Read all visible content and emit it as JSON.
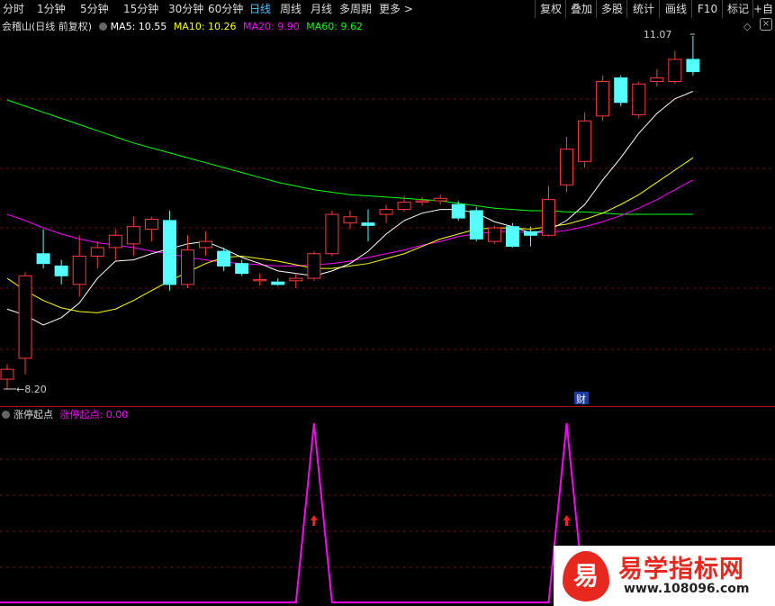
{
  "toolbar": {
    "tabs": [
      "分时",
      "1分钟",
      "5分钟",
      "15分钟",
      "30分钟",
      "60分钟",
      "日线",
      "周线",
      "月线",
      "多周期",
      "更多 >"
    ],
    "active_index": 6,
    "right_buttons": [
      "复权",
      "叠加",
      "多股",
      "统计",
      "画线",
      "F10",
      "标记",
      "+自"
    ]
  },
  "main_chart": {
    "title": "会稽山(日线 前复权)",
    "ma5": "MA5: 10.55",
    "ma10": "MA10: 10.26",
    "ma20": "MA20: 9.90",
    "ma60": "MA60: 9.62",
    "high_label": "11.07",
    "low_label": "8.20",
    "finance_marker": "财"
  },
  "indicator_panel": {
    "title": "涨停起点",
    "value_label": "涨停起点: 0.00"
  },
  "watermark": {
    "glyph": "易",
    "name": "易学指标网",
    "url": "www.108096.com"
  },
  "colors": {
    "up": "#ff3b3b",
    "down": "#54ffff",
    "ma5": "#ffffff",
    "ma10": "#ffff00",
    "ma20": "#ff00ff",
    "ma60": "#00ff00",
    "grid": "#7a0b0b",
    "indicator": "#ff00ff"
  },
  "chart_data": {
    "type": "candlestick",
    "y_range": [
      8.2,
      11.07
    ],
    "candles": [
      {
        "o": 8.28,
        "h": 8.4,
        "l": 8.2,
        "c": 8.36
      },
      {
        "o": 8.45,
        "h": 9.15,
        "l": 8.32,
        "c": 9.12
      },
      {
        "o": 9.3,
        "h": 9.5,
        "l": 9.18,
        "c": 9.22
      },
      {
        "o": 9.2,
        "h": 9.25,
        "l": 9.05,
        "c": 9.12
      },
      {
        "o": 9.05,
        "h": 9.45,
        "l": 8.95,
        "c": 9.28
      },
      {
        "o": 9.28,
        "h": 9.4,
        "l": 9.18,
        "c": 9.35
      },
      {
        "o": 9.35,
        "h": 9.5,
        "l": 9.25,
        "c": 9.45
      },
      {
        "o": 9.38,
        "h": 9.6,
        "l": 9.28,
        "c": 9.52
      },
      {
        "o": 9.5,
        "h": 9.6,
        "l": 9.4,
        "c": 9.58
      },
      {
        "o": 9.57,
        "h": 9.65,
        "l": 9.0,
        "c": 9.05
      },
      {
        "o": 9.05,
        "h": 9.45,
        "l": 9.02,
        "c": 9.33
      },
      {
        "o": 9.35,
        "h": 9.48,
        "l": 9.28,
        "c": 9.4
      },
      {
        "o": 9.32,
        "h": 9.35,
        "l": 9.16,
        "c": 9.2
      },
      {
        "o": 9.22,
        "h": 9.25,
        "l": 9.12,
        "c": 9.14
      },
      {
        "o": 9.08,
        "h": 9.14,
        "l": 9.04,
        "c": 9.09
      },
      {
        "o": 9.07,
        "h": 9.1,
        "l": 9.04,
        "c": 9.05
      },
      {
        "o": 9.08,
        "h": 9.14,
        "l": 9.02,
        "c": 9.1
      },
      {
        "o": 9.1,
        "h": 9.32,
        "l": 9.08,
        "c": 9.3
      },
      {
        "o": 9.3,
        "h": 9.65,
        "l": 9.28,
        "c": 9.62
      },
      {
        "o": 9.55,
        "h": 9.65,
        "l": 9.5,
        "c": 9.6
      },
      {
        "o": 9.55,
        "h": 9.66,
        "l": 9.4,
        "c": 9.53
      },
      {
        "o": 9.62,
        "h": 9.7,
        "l": 9.55,
        "c": 9.66
      },
      {
        "o": 9.66,
        "h": 9.77,
        "l": 9.64,
        "c": 9.72
      },
      {
        "o": 9.72,
        "h": 9.76,
        "l": 9.69,
        "c": 9.73
      },
      {
        "o": 9.73,
        "h": 9.78,
        "l": 9.7,
        "c": 9.75
      },
      {
        "o": 9.7,
        "h": 9.73,
        "l": 9.57,
        "c": 9.59
      },
      {
        "o": 9.65,
        "h": 9.68,
        "l": 9.4,
        "c": 9.42
      },
      {
        "o": 9.4,
        "h": 9.53,
        "l": 9.38,
        "c": 9.51
      },
      {
        "o": 9.52,
        "h": 9.55,
        "l": 9.35,
        "c": 9.36
      },
      {
        "o": 9.48,
        "h": 9.52,
        "l": 9.36,
        "c": 9.45
      },
      {
        "o": 9.45,
        "h": 9.85,
        "l": 9.44,
        "c": 9.74
      },
      {
        "o": 9.86,
        "h": 10.25,
        "l": 9.8,
        "c": 10.15
      },
      {
        "o": 10.05,
        "h": 10.45,
        "l": 10.0,
        "c": 10.38
      },
      {
        "o": 10.42,
        "h": 10.75,
        "l": 10.38,
        "c": 10.7
      },
      {
        "o": 10.73,
        "h": 10.75,
        "l": 10.5,
        "c": 10.53
      },
      {
        "o": 10.43,
        "h": 10.7,
        "l": 10.4,
        "c": 10.68
      },
      {
        "o": 10.7,
        "h": 10.8,
        "l": 10.66,
        "c": 10.73
      },
      {
        "o": 10.7,
        "h": 10.95,
        "l": 10.68,
        "c": 10.88
      },
      {
        "o": 10.88,
        "h": 11.07,
        "l": 10.75,
        "c": 10.78
      }
    ],
    "ma5": [
      8.85,
      8.8,
      8.72,
      8.78,
      8.9,
      9.1,
      9.24,
      9.25,
      9.3,
      9.34,
      9.38,
      9.4,
      9.34,
      9.27,
      9.22,
      9.16,
      9.14,
      9.12,
      9.16,
      9.22,
      9.32,
      9.46,
      9.57,
      9.63,
      9.66,
      9.66,
      9.63,
      9.56,
      9.52,
      9.47,
      9.49,
      9.57,
      9.7,
      9.9,
      10.08,
      10.28,
      10.44,
      10.56,
      10.62
    ],
    "ma10": [
      9.1,
      9.0,
      8.92,
      8.86,
      8.83,
      8.82,
      8.85,
      8.92,
      9.0,
      9.08,
      9.15,
      9.22,
      9.27,
      9.28,
      9.26,
      9.24,
      9.21,
      9.18,
      9.18,
      9.2,
      9.22,
      9.26,
      9.3,
      9.36,
      9.42,
      9.46,
      9.5,
      9.51,
      9.51,
      9.5,
      9.52,
      9.54,
      9.58,
      9.63,
      9.7,
      9.78,
      9.88,
      9.98,
      10.08
    ],
    "ma20": [
      9.62,
      9.57,
      9.51,
      9.46,
      9.42,
      9.39,
      9.37,
      9.35,
      9.32,
      9.3,
      9.27,
      9.25,
      9.23,
      9.22,
      9.21,
      9.2,
      9.2,
      9.21,
      9.22,
      9.24,
      9.27,
      9.3,
      9.33,
      9.37,
      9.4,
      9.44,
      9.46,
      9.48,
      9.48,
      9.47,
      9.47,
      9.49,
      9.52,
      9.56,
      9.61,
      9.67,
      9.74,
      9.82,
      9.9
    ],
    "ma60": [
      10.55,
      10.5,
      10.45,
      10.4,
      10.35,
      10.3,
      10.25,
      10.2,
      10.16,
      10.12,
      10.08,
      10.04,
      10.0,
      9.96,
      9.92,
      9.88,
      9.85,
      9.82,
      9.8,
      9.78,
      9.77,
      9.76,
      9.75,
      9.74,
      9.73,
      9.71,
      9.69,
      9.67,
      9.66,
      9.65,
      9.65,
      9.64,
      9.64,
      9.63,
      9.62,
      9.62,
      9.62,
      9.62,
      9.62
    ],
    "indicator_spikes": [
      17,
      31
    ]
  }
}
